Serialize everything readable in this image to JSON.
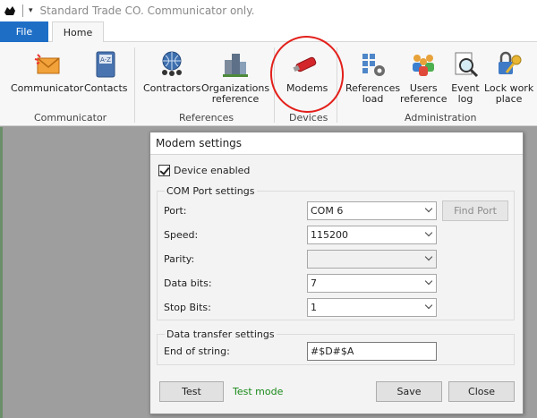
{
  "titlebar": {
    "title": "Standard Trade CO. Communicator only.",
    "dropdown_glyph": "▾"
  },
  "tabs": [
    {
      "label": "File",
      "active": false
    },
    {
      "label": "Home",
      "active": true
    }
  ],
  "ribbon": {
    "groups": [
      {
        "label": "Communicator",
        "buttons": [
          {
            "label": "Communicator",
            "icon": "envelope-star-icon"
          },
          {
            "label": "Contacts",
            "icon": "address-book-icon"
          }
        ]
      },
      {
        "label": "References",
        "buttons": [
          {
            "label": "Contractors",
            "icon": "globe-people-icon"
          },
          {
            "label_lines": [
              "Organizations",
              "reference"
            ],
            "icon": "buildings-icon"
          }
        ]
      },
      {
        "label": "Devices",
        "buttons": [
          {
            "label": "Modems",
            "icon": "usb-modem-icon"
          }
        ]
      },
      {
        "label": "Administration",
        "buttons": [
          {
            "label_lines": [
              "References",
              "load"
            ],
            "icon": "grid-gear-icon"
          },
          {
            "label_lines": [
              "Users",
              "reference"
            ],
            "icon": "users-icon"
          },
          {
            "label_lines": [
              "Event",
              "log"
            ],
            "icon": "magnifier-log-icon"
          },
          {
            "label_lines": [
              "Lock work",
              "place"
            ],
            "icon": "key-lock-icon"
          }
        ]
      }
    ]
  },
  "dialog": {
    "title": "Modem settings",
    "device_enabled_label": "Device enabled",
    "device_enabled": true,
    "com_group_title": "COM Port settings",
    "fields": {
      "port": {
        "label": "Port:",
        "value": "COM 6"
      },
      "speed": {
        "label": "Speed:",
        "value": "115200"
      },
      "parity": {
        "label": "Parity:",
        "value": ""
      },
      "data_bits": {
        "label": "Data bits:",
        "value": "7"
      },
      "stop_bits": {
        "label": "Stop Bits:",
        "value": "1"
      }
    },
    "find_port_label": "Find Port",
    "transfer_group_title": "Data transfer settings",
    "end_of_string": {
      "label": "End of string:",
      "value": "#$D#$A"
    },
    "test_label": "Test",
    "test_mode_text": "Test mode",
    "save_label": "Save",
    "close_label": "Close"
  },
  "colors": {
    "file_tab": "#1e6ec6",
    "annotation": "#e3201b",
    "test_mode_text": "#1a8a1a"
  }
}
